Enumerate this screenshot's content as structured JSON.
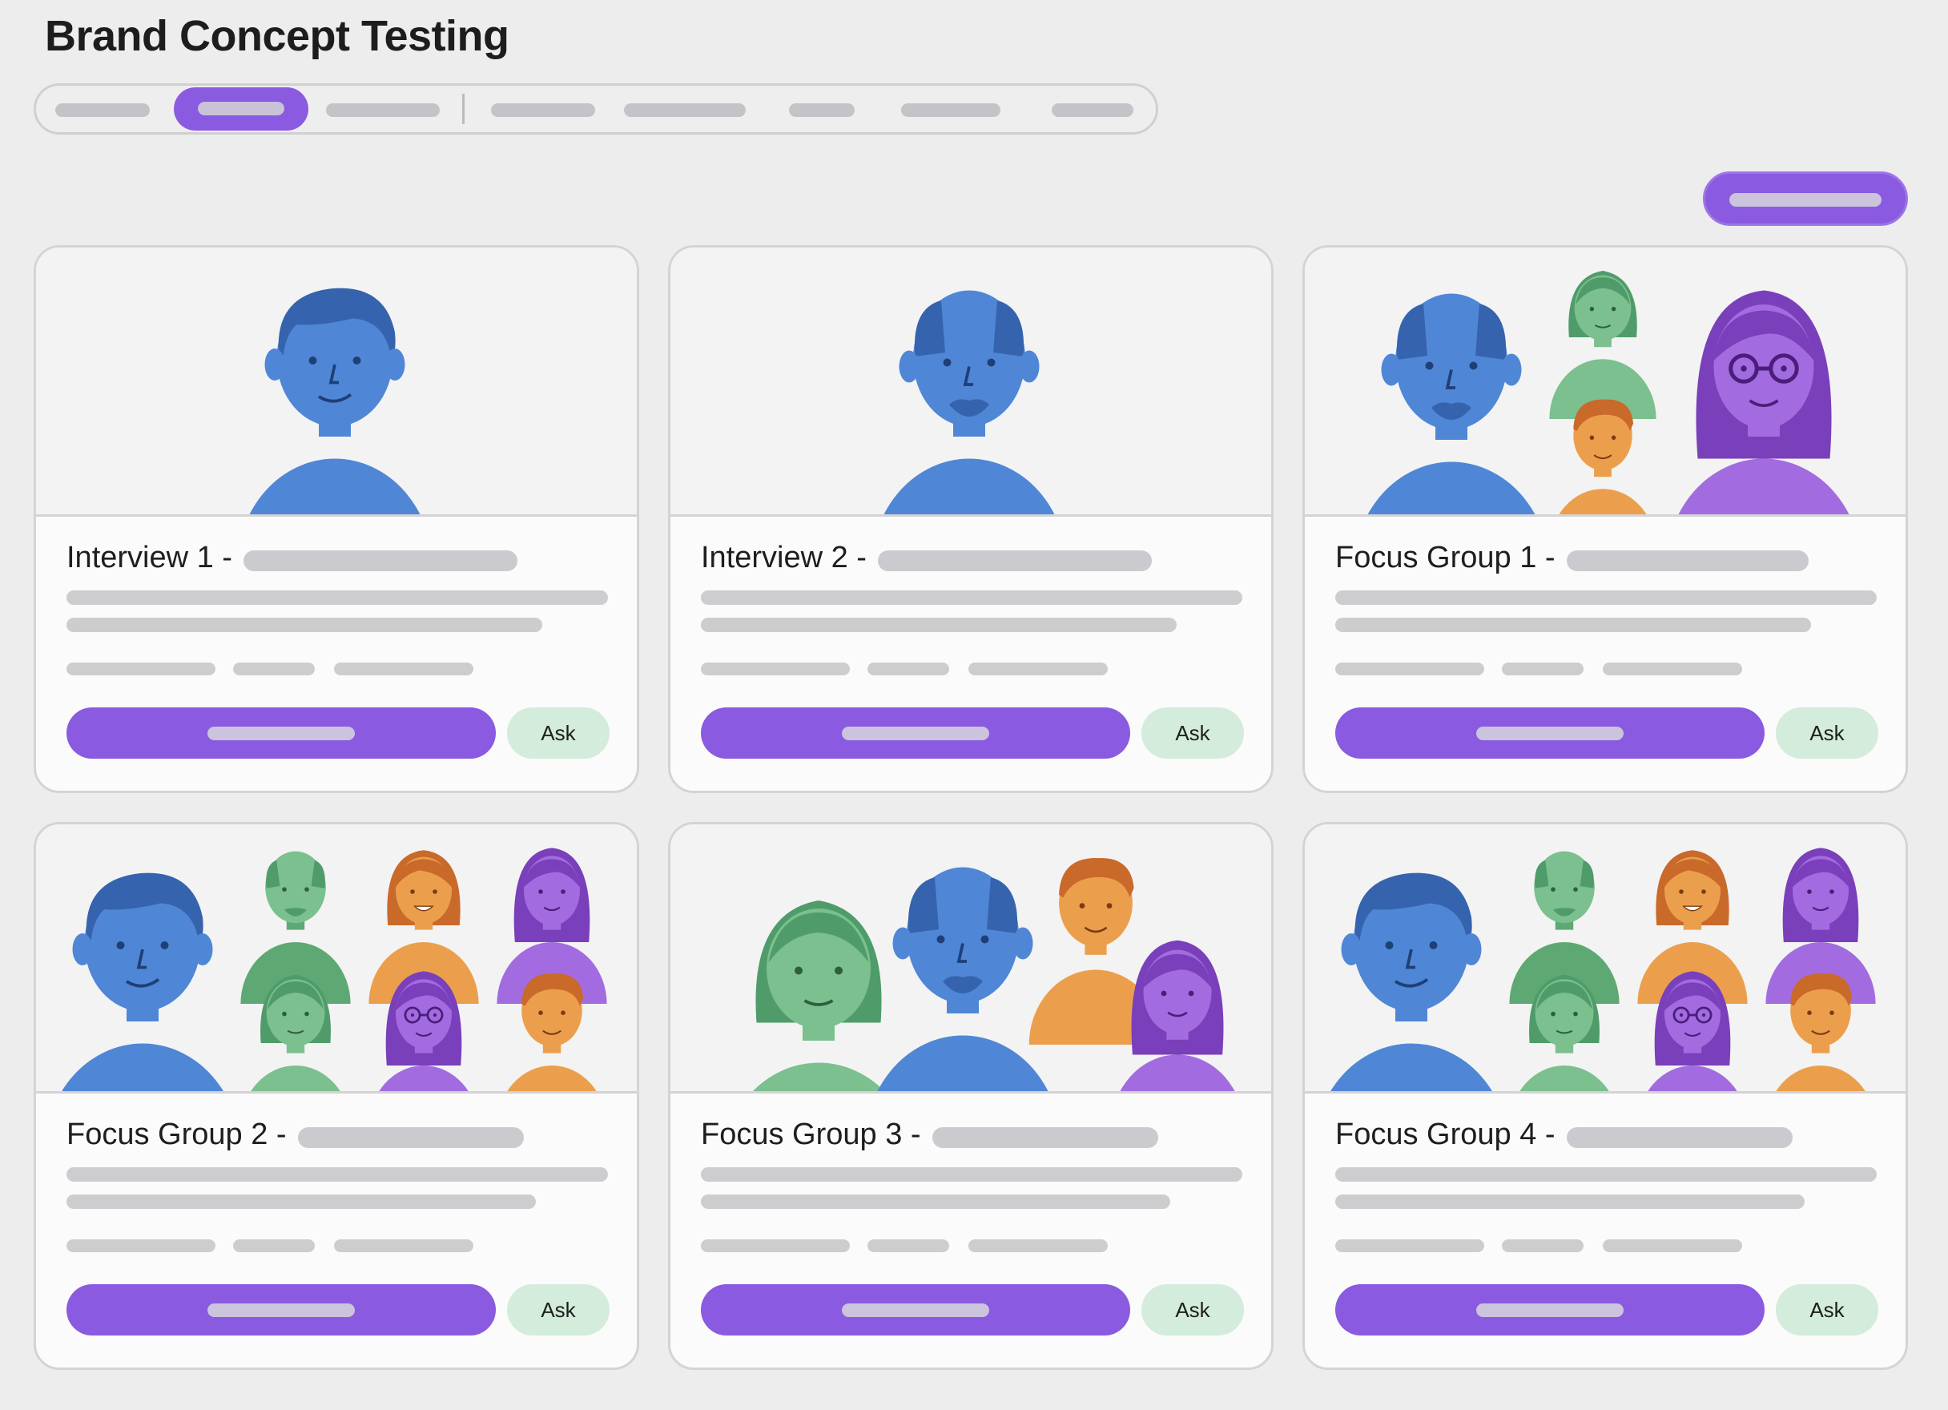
{
  "page": {
    "title": "Brand Concept Testing"
  },
  "tabs": [
    {
      "id": "tab-1",
      "label": ""
    },
    {
      "id": "tab-2",
      "label": "",
      "active": true
    },
    {
      "id": "tab-3",
      "label": ""
    },
    {
      "id": "tab-4",
      "label": ""
    },
    {
      "id": "tab-5",
      "label": ""
    },
    {
      "id": "tab-6",
      "label": ""
    },
    {
      "id": "tab-7",
      "label": ""
    },
    {
      "id": "tab-8",
      "label": ""
    }
  ],
  "cards": [
    {
      "title": "Interview 1 -",
      "ask_label": "Ask",
      "illustration": "single-participant"
    },
    {
      "title": "Interview 2 -",
      "ask_label": "Ask",
      "illustration": "single-participant"
    },
    {
      "title": "Focus Group 1 -",
      "ask_label": "Ask",
      "illustration": "group-4"
    },
    {
      "title": "Focus Group 2 -",
      "ask_label": "Ask",
      "illustration": "group-7"
    },
    {
      "title": "Focus Group 3 -",
      "ask_label": "Ask",
      "illustration": "group-4"
    },
    {
      "title": "Focus Group 4 -",
      "ask_label": "Ask",
      "illustration": "group-7"
    }
  ],
  "colors": {
    "accent": "#8a5ae0",
    "ask_button": "#d3ecdb",
    "avatar_blue": "#4f87d6",
    "avatar_green": "#7bc08e",
    "avatar_orange": "#eb9f4c",
    "avatar_purple": "#a26ce0"
  }
}
